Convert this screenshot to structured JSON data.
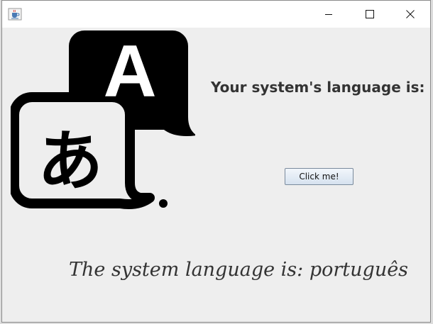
{
  "window": {
    "app_icon": "java-cup-icon",
    "controls": {
      "minimize_icon": "minimize-icon",
      "maximize_icon": "maximize-icon",
      "close_icon": "close-icon"
    }
  },
  "illustration": {
    "icon": "translate-language-icon",
    "back_glyph": "A",
    "front_glyph": "あ"
  },
  "main": {
    "heading": "Your system's language is:",
    "button_label": "Click me!",
    "result": "The system language is: português"
  },
  "colors": {
    "window_background": "#eeeeee",
    "titlebar": "#ffffff",
    "text": "#333333",
    "icon": "#000000"
  }
}
